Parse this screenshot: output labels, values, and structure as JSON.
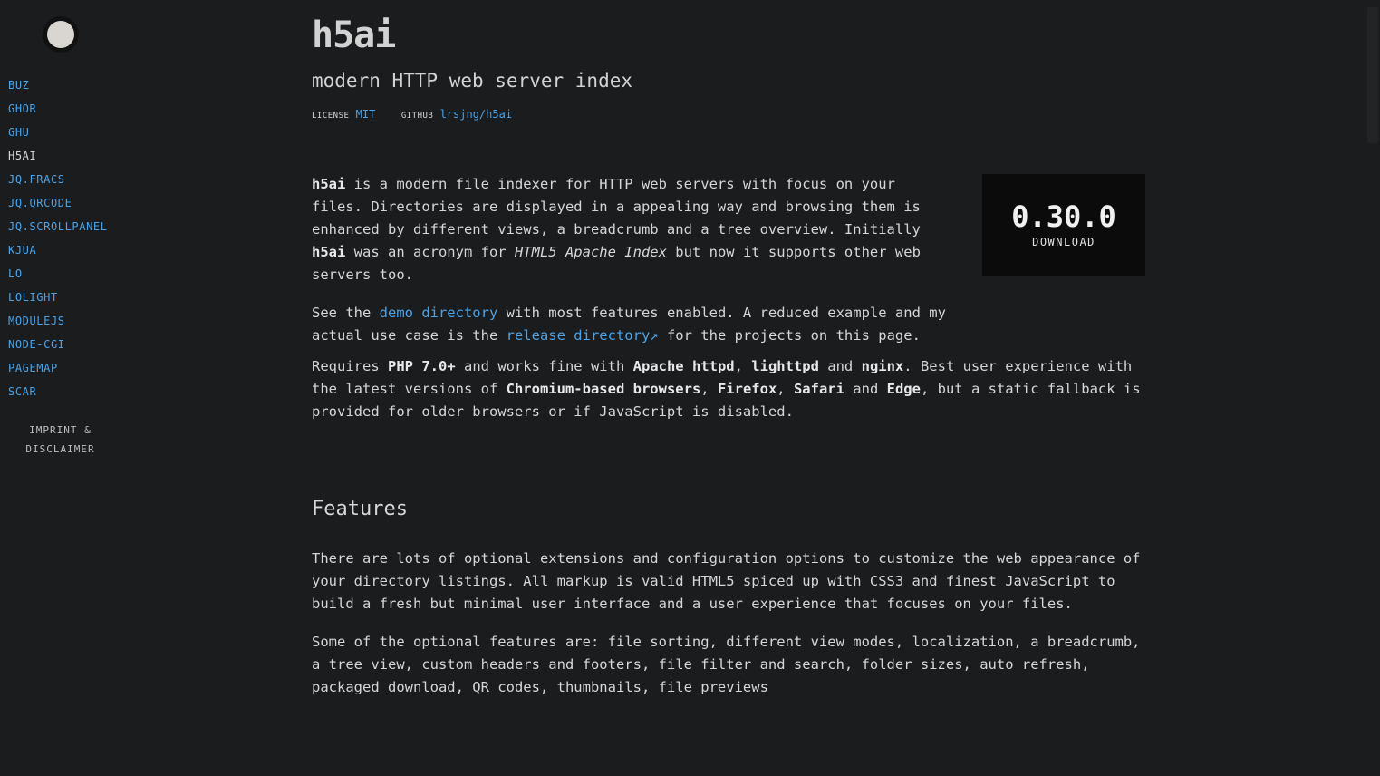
{
  "sidebar": {
    "nav": [
      "BUZ",
      "GHOR",
      "GHU",
      "H5AI",
      "JQ.FRACS",
      "JQ.QRCODE",
      "JQ.SCROLLPANEL",
      "KJUA",
      "LO",
      "LOLIGHT",
      "MODULEJS",
      "NODE-CGI",
      "PAGEMAP",
      "SCAR"
    ],
    "active": "H5AI",
    "imprint_line1": "IMPRINT &",
    "imprint_line2": "DISCLAIMER"
  },
  "header": {
    "title": "h5ai",
    "subtitle": "modern HTTP web server index",
    "license_key": "LICENSE",
    "license_value": "MIT",
    "github_key": "GITHUB",
    "github_value": "lrsjng/h5ai"
  },
  "intro": {
    "p1": {
      "b1": "h5ai",
      "t1": " is a modern file indexer for HTTP web servers with focus on your files. Directories are displayed in a appealing way and browsing them is enhanced by different views, a breadcrumb and a tree overview. Initially ",
      "b2": "h5ai",
      "t2": " was an acronym for ",
      "i1": "HTML5 Apache Index",
      "t3": " but now it supports other web servers too."
    },
    "p2": {
      "t1": "See the ",
      "link1": "demo directory",
      "t2": " with most features enabled. A reduced example and my actual use case is the ",
      "link2": "release directory↗",
      "t3": " for the projects on this page."
    },
    "p3": {
      "t1": "Requires ",
      "b1": "PHP 7.0+",
      "t2": " and works fine with ",
      "b2": "Apache httpd",
      "t3": ", ",
      "b3": "lighttpd",
      "t4": " and ",
      "b4": "nginx",
      "t5": ". Best user experience with the latest versions of ",
      "b5": "Chromium-based browsers",
      "t6": ", ",
      "b6": "Firefox",
      "t7": ", ",
      "b7": "Safari",
      "t8": " and ",
      "b8": "Edge",
      "t9": ", but a static fallback is provided for older browsers or if JavaScript is disabled."
    }
  },
  "download": {
    "version": "0.30.0",
    "label": "DOWNLOAD"
  },
  "features": {
    "heading": "Features",
    "p1": "There are lots of optional extensions and configuration options to customize the web appearance of your directory listings. All markup is valid HTML5 spiced up with CSS3 and finest JavaScript to build a fresh but minimal user interface and a user experience that focuses on your files.",
    "p2": "Some of the optional features are: file sorting, different view modes, localization, a breadcrumb, a tree view, custom headers and footers, file filter and search, folder sizes, auto refresh, packaged download, QR codes, thumbnails, file previews"
  },
  "colors": {
    "background": "#1b1c1e",
    "link": "#4aa3e8",
    "text": "#d6d6d6",
    "download_bg": "#0b0b0b"
  }
}
